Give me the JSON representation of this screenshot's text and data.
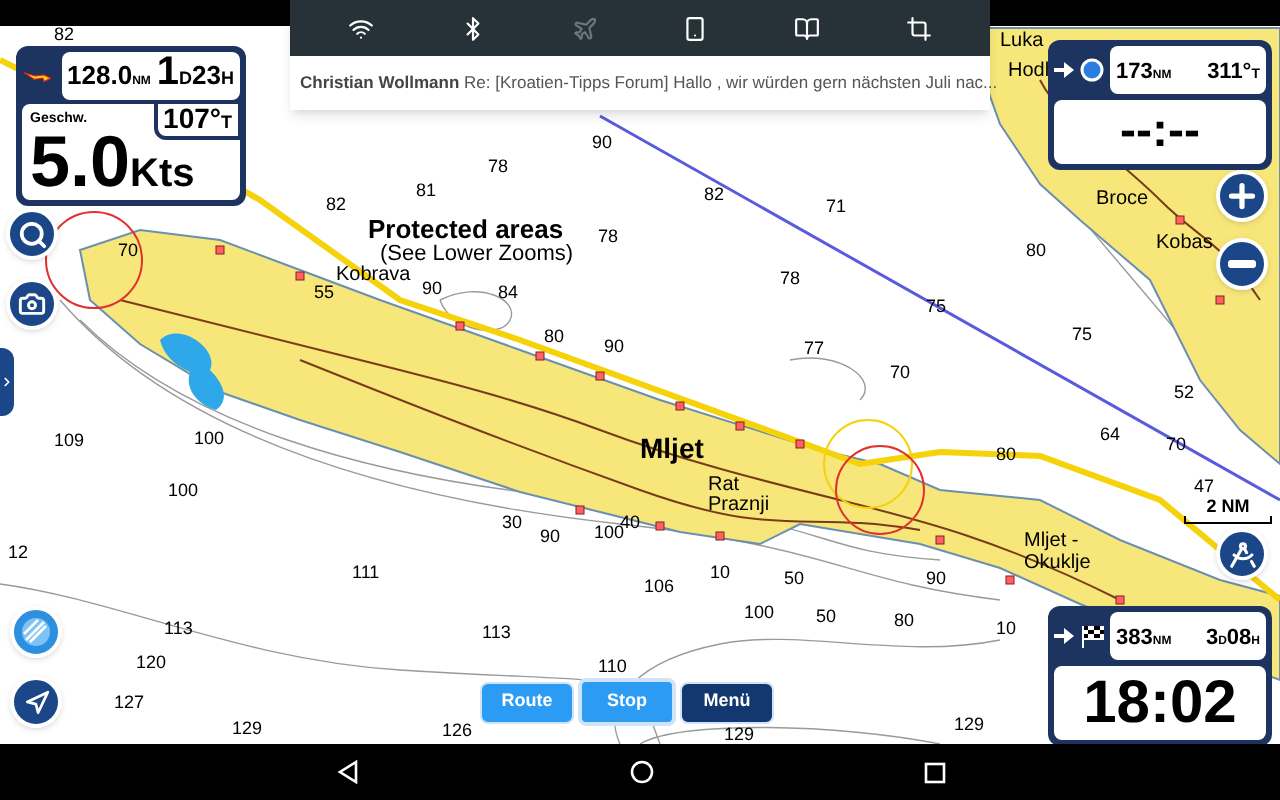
{
  "notification_panel": {
    "toggles": [
      {
        "kind": "wifi",
        "on": true
      },
      {
        "kind": "bluetooth",
        "on": true
      },
      {
        "kind": "airplane",
        "on": false
      },
      {
        "kind": "rotate",
        "on": true
      },
      {
        "kind": "reader",
        "on": true
      },
      {
        "kind": "crop",
        "on": true
      }
    ],
    "notification": {
      "sender": "Christian Wollmann",
      "text": "Re: [Kroatien-Tipps Forum] Hallo , wir würden gern nächsten Juli nac..."
    }
  },
  "trip_widget": {
    "distance": {
      "value": "128.0",
      "unit": "NM"
    },
    "days": {
      "value": "1",
      "unit": "D"
    },
    "hours": {
      "value": "23",
      "unit": "H"
    },
    "heading": {
      "value": "107°",
      "unit": "T"
    },
    "speed_label": "Geschw.",
    "speed": {
      "value": "5.0",
      "unit": "Kts"
    }
  },
  "waypoint_widget": {
    "distance": {
      "value": "173",
      "unit": "NM"
    },
    "bearing": {
      "value": "311°",
      "unit": "T"
    },
    "time": "--:--"
  },
  "destination_widget": {
    "distance": {
      "value": "383",
      "unit": "NM"
    },
    "days": {
      "value": "3",
      "unit": "D"
    },
    "hours": {
      "value": "08",
      "unit": "H"
    },
    "eta": "18:02"
  },
  "map": {
    "labels": [
      {
        "kind": "title",
        "text": "Protected areas"
      },
      {
        "kind": "note",
        "text": "(See Lower Zooms)"
      },
      {
        "kind": "island",
        "text": "Mljet"
      },
      {
        "kind": "place",
        "text": "Rat"
      },
      {
        "kind": "place",
        "text": "Praznji"
      },
      {
        "kind": "place",
        "text": "Mljet -"
      },
      {
        "kind": "place",
        "text": "Okuklje"
      },
      {
        "kind": "place",
        "text": "Kobrava"
      },
      {
        "kind": "place",
        "text": "Broce"
      },
      {
        "kind": "place",
        "text": "Kobas"
      },
      {
        "kind": "place",
        "text": "Luka"
      },
      {
        "kind": "place",
        "text": "Hodl"
      }
    ],
    "soundings": [
      "82",
      "90",
      "78",
      "82",
      "81",
      "82",
      "71",
      "70",
      "78",
      "80",
      "55",
      "90",
      "84",
      "78",
      "75",
      "80",
      "90",
      "77",
      "75",
      "70",
      "52",
      "109",
      "100",
      "80",
      "64",
      "70",
      "100",
      "47",
      "30",
      "90",
      "100",
      "40",
      "12",
      "111",
      "106",
      "10",
      "50",
      "90",
      "113",
      "113",
      "100",
      "50",
      "80",
      "10",
      "120",
      "127",
      "110",
      "129",
      "126",
      "129",
      "129"
    ],
    "scale": "2 NM"
  },
  "bottom_buttons": [
    {
      "kind": "action",
      "label": "Route",
      "selected": false
    },
    {
      "kind": "action",
      "label": "Stop",
      "selected": true
    },
    {
      "kind": "menu",
      "label": "Menü",
      "selected": false
    }
  ]
}
